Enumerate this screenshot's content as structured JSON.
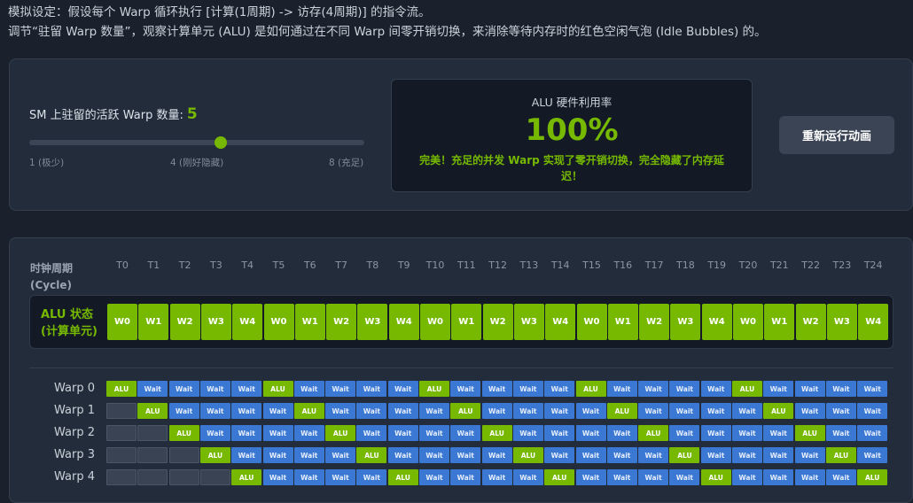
{
  "intro": {
    "line1": "模拟设定：假设每个 Warp 循环执行 [计算(1周期) -> 访存(4周期)] 的指令流。",
    "line2": "调节“驻留 Warp 数量”，观察计算单元 (ALU) 是如何通过在不同 Warp 间零开销切换，来消除等待内存时的红色空闲气泡 (Idle Bubbles) 的。"
  },
  "controls": {
    "slider_label": "SM 上驻留的活跃 Warp 数量:",
    "slider_value": "5",
    "slider_min": 1,
    "slider_max": 8,
    "slider_current": 5,
    "tick_min": "1 (极少)",
    "tick_mid": "4 (刚好隐藏)",
    "tick_max": "8 (充足)",
    "rerun_label": "重新运行动画"
  },
  "utilization": {
    "title": "ALU 硬件利用率",
    "value": "100%",
    "message": "完美！充足的并发 Warp 实现了零开销切换，完全隐藏了内存延迟！"
  },
  "timeline": {
    "axis_title_1": "时钟周期",
    "axis_title_2": "(Cycle)",
    "cycles": [
      "T0",
      "T1",
      "T2",
      "T3",
      "T4",
      "T5",
      "T6",
      "T7",
      "T8",
      "T9",
      "T10",
      "T11",
      "T12",
      "T13",
      "T14",
      "T15",
      "T16",
      "T17",
      "T18",
      "T19",
      "T20",
      "T21",
      "T22",
      "T23",
      "T24"
    ],
    "alu_label_1": "ALU 状态",
    "alu_label_2": "(计算单元)",
    "alu_state": [
      "W0",
      "W1",
      "W2",
      "W3",
      "W4",
      "W0",
      "W1",
      "W2",
      "W3",
      "W4",
      "W0",
      "W1",
      "W2",
      "W3",
      "W4",
      "W0",
      "W1",
      "W2",
      "W3",
      "W4",
      "W0",
      "W1",
      "W2",
      "W3",
      "W4"
    ],
    "alu_text": "ALU",
    "wait_text": "Wait",
    "warps": [
      {
        "label": "Warp 0",
        "start": 0
      },
      {
        "label": "Warp 1",
        "start": 1
      },
      {
        "label": "Warp 2",
        "start": 2
      },
      {
        "label": "Warp 3",
        "start": 3
      },
      {
        "label": "Warp 4",
        "start": 4
      }
    ],
    "colors": {
      "alu": "#76b900",
      "wait": "#3a78d4",
      "empty": "#3a4354"
    }
  }
}
